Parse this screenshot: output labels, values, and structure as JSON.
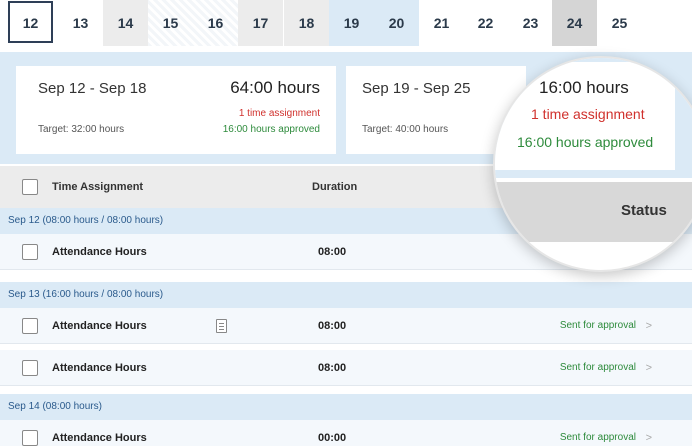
{
  "days": [
    {
      "num": "12",
      "state": "selected"
    },
    {
      "num": "13",
      "state": "normal"
    },
    {
      "num": "14",
      "state": "weekend"
    },
    {
      "num": "15",
      "state": "hatch"
    },
    {
      "num": "16",
      "state": "hatch"
    },
    {
      "num": "17",
      "state": "weekend"
    },
    {
      "num": "18",
      "state": "weekend"
    },
    {
      "num": "19",
      "state": "blue"
    },
    {
      "num": "20",
      "state": "blue"
    },
    {
      "num": "21",
      "state": "normal"
    },
    {
      "num": "22",
      "state": "normal"
    },
    {
      "num": "23",
      "state": "normal"
    },
    {
      "num": "24",
      "state": "gray-dark"
    },
    {
      "num": "25",
      "state": "normal"
    }
  ],
  "weeks": [
    {
      "range": "Sep 12 - Sep 18",
      "hours": "64:00 hours",
      "target": "Target: 32:00 hours",
      "assignments": "1 time assignment",
      "approved": "16:00 hours approved"
    },
    {
      "range": "Sep 19 - Sep 25",
      "hours": "16:00 hours",
      "target": "Target: 40:00 hours",
      "assignments": "1 time assignment",
      "approved": "16:00 hours approved"
    }
  ],
  "table": {
    "col_assignment": "Time Assignment",
    "col_duration": "Duration",
    "col_status": "Status"
  },
  "groups": [
    {
      "label": "Sep 12 (08:00 hours / 08:00 hours)"
    },
    {
      "label": "Sep 13 (16:00 hours / 08:00 hours)"
    },
    {
      "label": "Sep 14 (08:00 hours)"
    }
  ],
  "rows": [
    {
      "name": "Attendance Hours",
      "duration": "08:00",
      "status": "",
      "note": false
    },
    {
      "name": "Attendance Hours",
      "duration": "08:00",
      "status": "Sent for approval",
      "note": true
    },
    {
      "name": "Attendance Hours",
      "duration": "08:00",
      "status": "Sent for approval",
      "note": false
    },
    {
      "name": "Attendance Hours",
      "duration": "00:00",
      "status": "Sent for approval",
      "note": false
    }
  ],
  "magnifier": {
    "hours": "16:00 hours",
    "assignments": "1 time assignment",
    "approved": "16:00 hours approved",
    "status_label": "Status"
  },
  "colors": {
    "accent_blue": "#dbeaf6",
    "approved_green": "#2e8b3c",
    "assignment_red": "#d0312d"
  }
}
